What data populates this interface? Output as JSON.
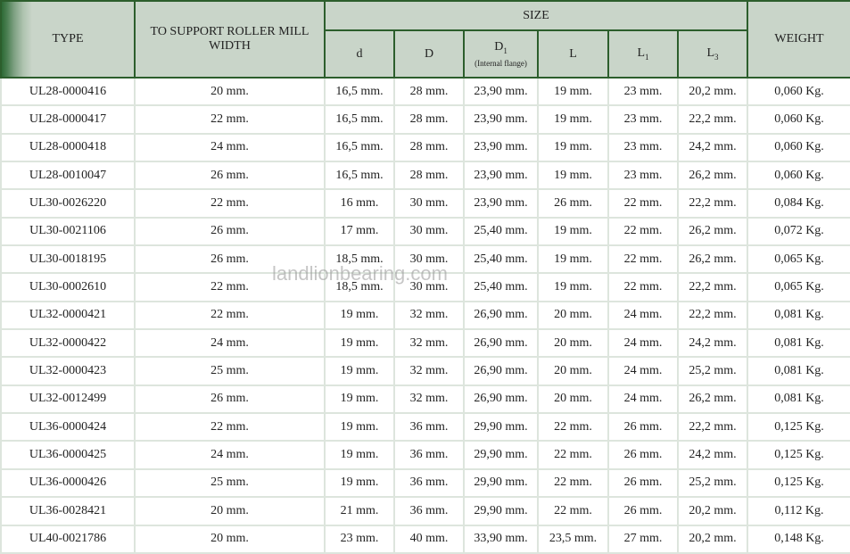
{
  "headers": {
    "type": "TYPE",
    "width": "TO SUPPORT ROLLER MILL WIDTH",
    "size": "SIZE",
    "d": "d",
    "D": "D",
    "D1": "D",
    "D1_sub": "1",
    "D1_note": "(Internal flange)",
    "L": "L",
    "L1": "L",
    "L1_sub": "1",
    "L3": "L",
    "L3_sub": "3",
    "weight": "WEIGHT"
  },
  "rows": [
    [
      "UL28-0000416",
      "20 mm.",
      "16,5 mm.",
      "28 mm.",
      "23,90 mm.",
      "19 mm.",
      "23 mm.",
      "20,2 mm.",
      "0,060 Kg."
    ],
    [
      "UL28-0000417",
      "22 mm.",
      "16,5 mm.",
      "28 mm.",
      "23,90 mm.",
      "19 mm.",
      "23 mm.",
      "22,2 mm.",
      "0,060 Kg."
    ],
    [
      "UL28-0000418",
      "24 mm.",
      "16,5 mm.",
      "28 mm.",
      "23,90 mm.",
      "19 mm.",
      "23 mm.",
      "24,2 mm.",
      "0,060 Kg."
    ],
    [
      "UL28-0010047",
      "26 mm.",
      "16,5 mm.",
      "28 mm.",
      "23,90 mm.",
      "19 mm.",
      "23 mm.",
      "26,2 mm.",
      "0,060 Kg."
    ],
    [
      "UL30-0026220",
      "22 mm.",
      "16 mm.",
      "30 mm.",
      "23,90 mm.",
      "26 mm.",
      "22 mm.",
      "22,2 mm.",
      "0,084 Kg."
    ],
    [
      "UL30-0021106",
      "26 mm.",
      "17 mm.",
      "30 mm.",
      "25,40 mm.",
      "19 mm.",
      "22 mm.",
      "26,2 mm.",
      "0,072 Kg."
    ],
    [
      "UL30-0018195",
      "26 mm.",
      "18,5 mm.",
      "30 mm.",
      "25,40 mm.",
      "19 mm.",
      "22 mm.",
      "26,2 mm.",
      "0,065 Kg."
    ],
    [
      "UL30-0002610",
      "22 mm.",
      "18,5 mm.",
      "30 mm.",
      "25,40 mm.",
      "19 mm.",
      "22 mm.",
      "22,2 mm.",
      "0,065 Kg."
    ],
    [
      "UL32-0000421",
      "22 mm.",
      "19 mm.",
      "32 mm.",
      "26,90 mm.",
      "20 mm.",
      "24 mm.",
      "22,2 mm.",
      "0,081 Kg."
    ],
    [
      "UL32-0000422",
      "24 mm.",
      "19 mm.",
      "32 mm.",
      "26,90 mm.",
      "20 mm.",
      "24 mm.",
      "24,2 mm.",
      "0,081 Kg."
    ],
    [
      "UL32-0000423",
      "25 mm.",
      "19 mm.",
      "32 mm.",
      "26,90 mm.",
      "20 mm.",
      "24 mm.",
      "25,2 mm.",
      "0,081 Kg."
    ],
    [
      "UL32-0012499",
      "26 mm.",
      "19 mm.",
      "32 mm.",
      "26,90 mm.",
      "20 mm.",
      "24 mm.",
      "26,2 mm.",
      "0,081 Kg."
    ],
    [
      "UL36-0000424",
      "22 mm.",
      "19 mm.",
      "36 mm.",
      "29,90 mm.",
      "22 mm.",
      "26 mm.",
      "22,2 mm.",
      "0,125 Kg."
    ],
    [
      "UL36-0000425",
      "24 mm.",
      "19 mm.",
      "36 mm.",
      "29,90 mm.",
      "22 mm.",
      "26 mm.",
      "24,2 mm.",
      "0,125 Kg."
    ],
    [
      "UL36-0000426",
      "25 mm.",
      "19 mm.",
      "36 mm.",
      "29,90 mm.",
      "22 mm.",
      "26 mm.",
      "25,2 mm.",
      "0,125 Kg."
    ],
    [
      "UL36-0028421",
      "20 mm.",
      "21 mm.",
      "36 mm.",
      "29,90 mm.",
      "22 mm.",
      "26 mm.",
      "20,2 mm.",
      "0,112 Kg."
    ],
    [
      "UL40-0021786",
      "20 mm.",
      "23 mm.",
      "40 mm.",
      "33,90 mm.",
      "23,5 mm.",
      "27 mm.",
      "20,2 mm.",
      "0,148 Kg."
    ]
  ],
  "watermark": "landlionbearing.com",
  "colors": {
    "header_bg": "#c9d5c9",
    "header_border": "#2c5e2c",
    "grid": "#dde5dd"
  }
}
